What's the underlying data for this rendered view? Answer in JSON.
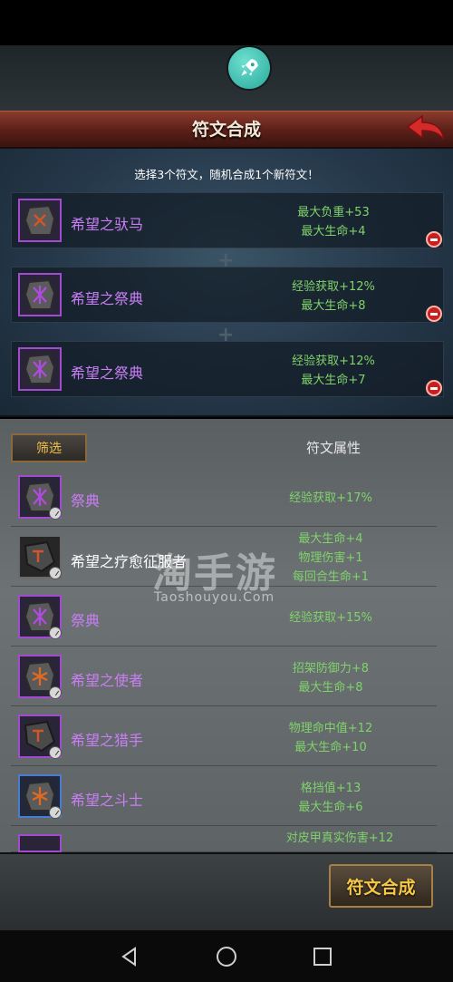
{
  "header": {
    "title": "符文合成",
    "hint": "选择3个符文，随机合成1个新符文！"
  },
  "selected_slots": [
    {
      "name": "希望之驮马",
      "stat1": "最大负重+53",
      "stat2": "最大生命+4",
      "rune_color": "purple"
    },
    {
      "name": "希望之祭典",
      "stat1": "经验获取+12%",
      "stat2": "最大生命+8",
      "rune_color": "purple"
    },
    {
      "name": "希望之祭典",
      "stat1": "经验获取+12%",
      "stat2": "最大生命+7",
      "rune_color": "purple"
    }
  ],
  "list_header": {
    "filter_label": "筛选",
    "attr_label": "符文属性"
  },
  "rune_list": [
    {
      "name": "祭典",
      "stats": [
        "经验获取+17%"
      ],
      "rune_color": "purple"
    },
    {
      "name": "希望之疗愈征服者",
      "stats": [
        "最大生命+4",
        "物理伤害+1",
        "每回合生命+1"
      ],
      "rune_color": "gray"
    },
    {
      "name": "祭典",
      "stats": [
        "经验获取+15%"
      ],
      "rune_color": "purple"
    },
    {
      "name": "希望之使者",
      "stats": [
        "招架防御力+8",
        "最大生命+8"
      ],
      "rune_color": "purple"
    },
    {
      "name": "希望之猎手",
      "stats": [
        "物理命中值+12",
        "最大生命+10"
      ],
      "rune_color": "purple"
    },
    {
      "name": "希望之斗士",
      "stats": [
        "格挡值+13",
        "最大生命+6"
      ],
      "rune_color": "blue"
    },
    {
      "name": "",
      "stats": [
        "对皮甲真实伤害+12"
      ],
      "rune_color": "purple"
    }
  ],
  "watermark": {
    "main": "淘手游",
    "sub": "Taoshouyou.Com"
  },
  "footer": {
    "synth_label": "符文合成"
  },
  "colors": {
    "rune_purple": "#c97ef5",
    "stat_green": "#7fd36a",
    "button_gold": "#f6c845",
    "title_red": "#5a1f18"
  }
}
